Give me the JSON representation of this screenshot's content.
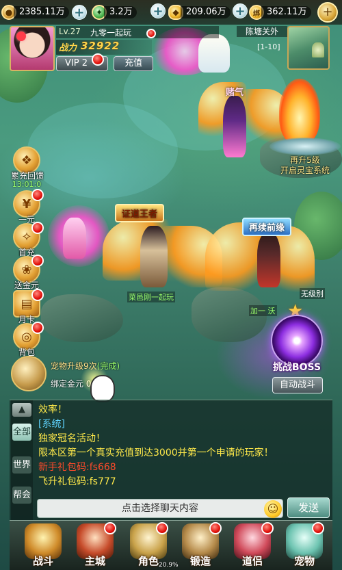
{
  "resources": [
    {
      "icon": "copper-coin-icon",
      "value": "2385.11万"
    },
    {
      "icon": "jade-leaf-icon",
      "value": "3.2万"
    },
    {
      "icon": "gold-ingot-icon",
      "value": "209.06万"
    },
    {
      "icon": "bound-ingot-icon",
      "icon_text": "绑",
      "value": "362.11万"
    }
  ],
  "player": {
    "level": "Lv.27",
    "name": "九零一起玩",
    "power_label": "战力",
    "power": "32922",
    "vip": "VIP 2",
    "recharge_label": "充值"
  },
  "map": {
    "name": "陈塘关外",
    "line": "[1-10]"
  },
  "scene_labels": {
    "title_zhengdao": "证道王者",
    "title_zaixu": "再续前缘",
    "title_ganqi": "赌气",
    "name_1": "菜邑刚一起玩",
    "name_2": "加一 沃",
    "no_level": "无级别"
  },
  "left_buttons": [
    {
      "label": "累充回馈",
      "sub": "13:01:0",
      "icon": "gift-box-icon"
    },
    {
      "label": "一元",
      "icon": "one-yuan-icon"
    },
    {
      "label": "首充",
      "icon": "first-recharge-icon"
    },
    {
      "label": "送金元",
      "icon": "gold-gift-icon"
    },
    {
      "label": "月卡",
      "icon": "month-card-icon"
    },
    {
      "label": "背包",
      "icon": "bag-icon"
    }
  ],
  "treasure": {
    "line1": "再升5级",
    "line2": "开启灵宝系统"
  },
  "boss": {
    "label": "挑战BOSS"
  },
  "auto_battle": {
    "label": "自动战斗"
  },
  "task": {
    "line1": "宠物升级9次",
    "line1_status": "(完成)",
    "line2": "绑定金元 0"
  },
  "chat": {
    "tabs": [
      "全部",
      "世界",
      "帮会"
    ],
    "lines": [
      {
        "text": "效率！",
        "color": "#ffe94a"
      },
      {
        "text": "[系统]",
        "color": "#5fd4ff"
      },
      {
        "text": "独家冠名活动！",
        "color": "#ffe94a"
      },
      {
        "text": "限本区第一个真实充值到达3000并第一个申请的玩家！",
        "color": "#ffe94a"
      },
      {
        "text": "新手礼包码:fs668",
        "color": "#ff4a2a"
      },
      {
        "text": "飞升礼包码:fs777",
        "color": "#ffe94a"
      }
    ],
    "placeholder": "点击选择聊天内容",
    "send_label": "发送"
  },
  "nav": [
    {
      "label": "战斗",
      "icon": "battle-icon"
    },
    {
      "label": "主城",
      "icon": "city-icon"
    },
    {
      "label": "角色",
      "icon": "character-icon"
    },
    {
      "label": "锻造",
      "icon": "forge-icon"
    },
    {
      "label": "道侣",
      "icon": "partner-icon"
    },
    {
      "label": "宠物",
      "icon": "pet-icon"
    }
  ],
  "exp_progress": "20.9%"
}
